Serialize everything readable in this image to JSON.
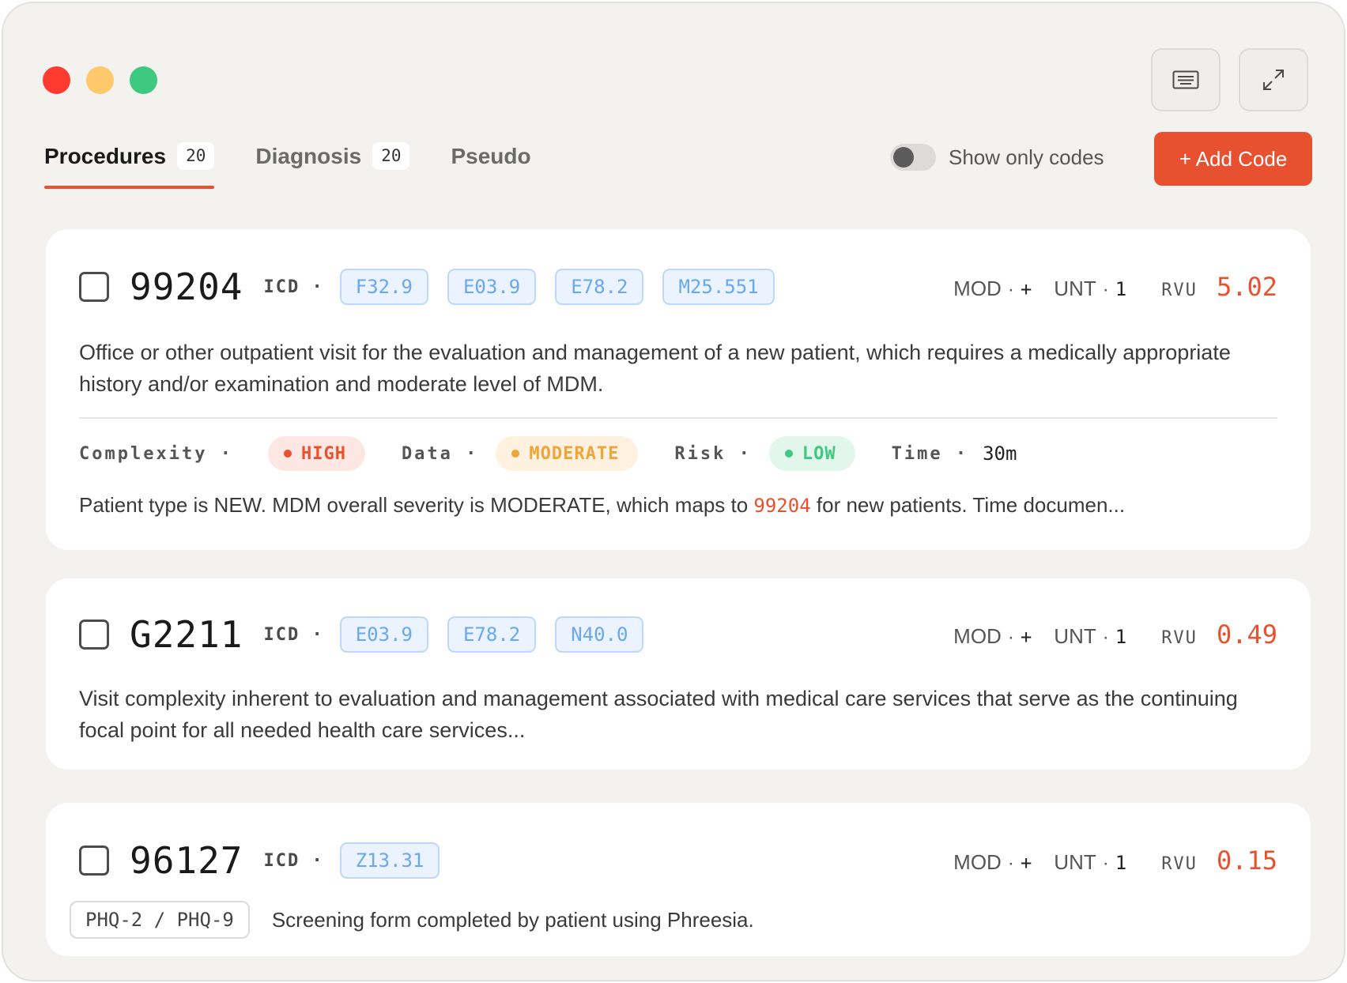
{
  "window": {
    "controls": [
      "close",
      "minimize",
      "maximize"
    ]
  },
  "toolbar": {
    "left_icon": "keyboard-icon",
    "right_icon": "expand-icon"
  },
  "tabs": [
    {
      "label": "Procedures",
      "count": "20",
      "active": true
    },
    {
      "label": "Diagnosis",
      "count": "20",
      "active": false
    },
    {
      "label": "Pseudo",
      "active": false
    }
  ],
  "filter": {
    "toggle_label": "Show only codes",
    "toggle_on": false
  },
  "add_button": {
    "label": "+ Add Code"
  },
  "labels": {
    "icd": "ICD ·",
    "mod": "MOD",
    "unt": "UNT",
    "rvu": "RVU",
    "dot": "·"
  },
  "cards": [
    {
      "code": "99204",
      "icd": [
        "F32.9",
        "E03.9",
        "E78.2",
        "M25.551"
      ],
      "mod": "+",
      "unt": "1",
      "rvu": "5.02",
      "description": "Office or other outpatient visit for the evaluation and management of a new patient, which requires a medically appropriate history and/or examination and moderate level of MDM.",
      "mdm": {
        "complexity_label": "Complexity ·",
        "complexity": "HIGH",
        "data_label": "Data ·",
        "data": "MODERATE",
        "risk_label": "Risk ·",
        "risk": "LOW",
        "time_label": "Time ·",
        "time": "30m"
      },
      "summary_pre": "Patient type is NEW. MDM overall severity is MODERATE, which maps to ",
      "summary_code": "99204",
      "summary_post": " for new patients. Time documen..."
    },
    {
      "code": "G2211",
      "icd": [
        "E03.9",
        "E78.2",
        "N40.0"
      ],
      "mod": "+",
      "unt": "1",
      "rvu": "0.49",
      "description": "Visit complexity inherent to evaluation and management associated with medical care services that serve as the continuing focal point for all needed health care services..."
    },
    {
      "code": "96127",
      "icd": [
        "Z13.31"
      ],
      "mod": "+",
      "unt": "1",
      "rvu": "0.15",
      "tag": "PHQ-2 / PHQ-9",
      "note": "Screening form completed by patient using Phreesia."
    }
  ],
  "colors": {
    "accent": "#e8512f",
    "icd_chip": "#6aa7ee",
    "high": "#e8512f",
    "moderate": "#eea53a",
    "low": "#3dc97f"
  }
}
